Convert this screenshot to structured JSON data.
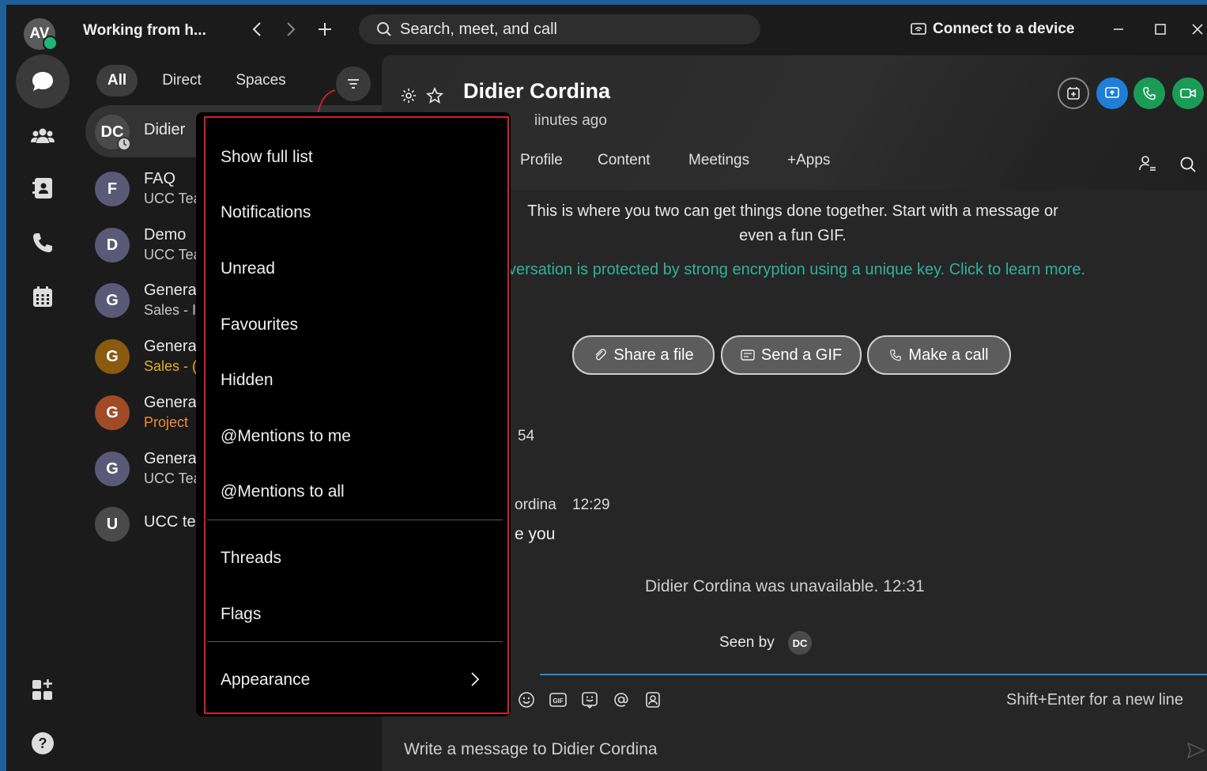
{
  "titlebar": {
    "avatar_initials": "AV",
    "status": "Working from h...",
    "nav_back": "‹",
    "nav_forward": "›",
    "new": "+",
    "search_placeholder": "Search, meet, and call",
    "connect_label": "Connect to a device"
  },
  "filters": {
    "all": "All",
    "direct": "Direct",
    "spaces": "Spaces"
  },
  "list": [
    {
      "initials": "DC",
      "title": "Didier",
      "sub": "",
      "color": "#4a4a4a",
      "sub_color": "#c8c8c8"
    },
    {
      "initials": "F",
      "title": "FAQ",
      "sub": "UCC Tea",
      "color": "#5a5a78",
      "sub_color": "#c8c8c8"
    },
    {
      "initials": "D",
      "title": "Demo",
      "sub": "UCC Tea",
      "color": "#5a5a78",
      "sub_color": "#c8c8c8"
    },
    {
      "initials": "G",
      "title": "Genera",
      "sub": "Sales - I",
      "color": "#5a5a78",
      "sub_color": "#c8c8c8"
    },
    {
      "initials": "G",
      "title": "Genera",
      "sub": "Sales - (",
      "color": "#8a5a10",
      "sub_color": "#e0b020"
    },
    {
      "initials": "G",
      "title": "Genera",
      "sub": "Project",
      "color": "#a04b25",
      "sub_color": "#f08a3c"
    },
    {
      "initials": "G",
      "title": "Genera",
      "sub": "UCC Tea",
      "color": "#5a5a78",
      "sub_color": "#c8c8c8"
    },
    {
      "initials": "U",
      "title": "UCC te",
      "sub": "",
      "color": "#4a4a4a",
      "sub_color": "#c8c8c8"
    }
  ],
  "main": {
    "title": "Didier Cordina",
    "subtitle": "iinutes ago",
    "tabs": [
      "Profile",
      "Content",
      "Meetings",
      "+Apps"
    ],
    "intro": "This is where you two can get things done together. Start with a message or even a fun GIF.",
    "encryption": "versation is protected by strong encryption using a unique key. Click to learn more.",
    "actions": [
      "Share a file",
      "Send a GIF",
      "Make a call"
    ],
    "time_fragment": "54",
    "sender_fragment": "ordina",
    "sender_time": "12:29",
    "message_fragment": "e you",
    "unavailable": "Didier Cordina was unavailable. 12:31",
    "seen_by": "Seen by",
    "seen_initials": "DC",
    "composer_hint": "Shift+Enter for a new line",
    "composer_placeholder": "Write a message to Didier Cordina"
  },
  "dropdown": {
    "items": [
      "Show full list",
      "Notifications",
      "Unread",
      "Favourites",
      "Hidden",
      "@Mentions to me",
      "@Mentions to all",
      "Threads",
      "Flags",
      "Appearance"
    ]
  },
  "colors": {
    "accent_blue": "#1f7fd8",
    "call_green": "#1a9c57",
    "presence_green": "#1fb67a",
    "encryption_teal": "#2fb39a",
    "highlight_red": "#d0222b"
  }
}
